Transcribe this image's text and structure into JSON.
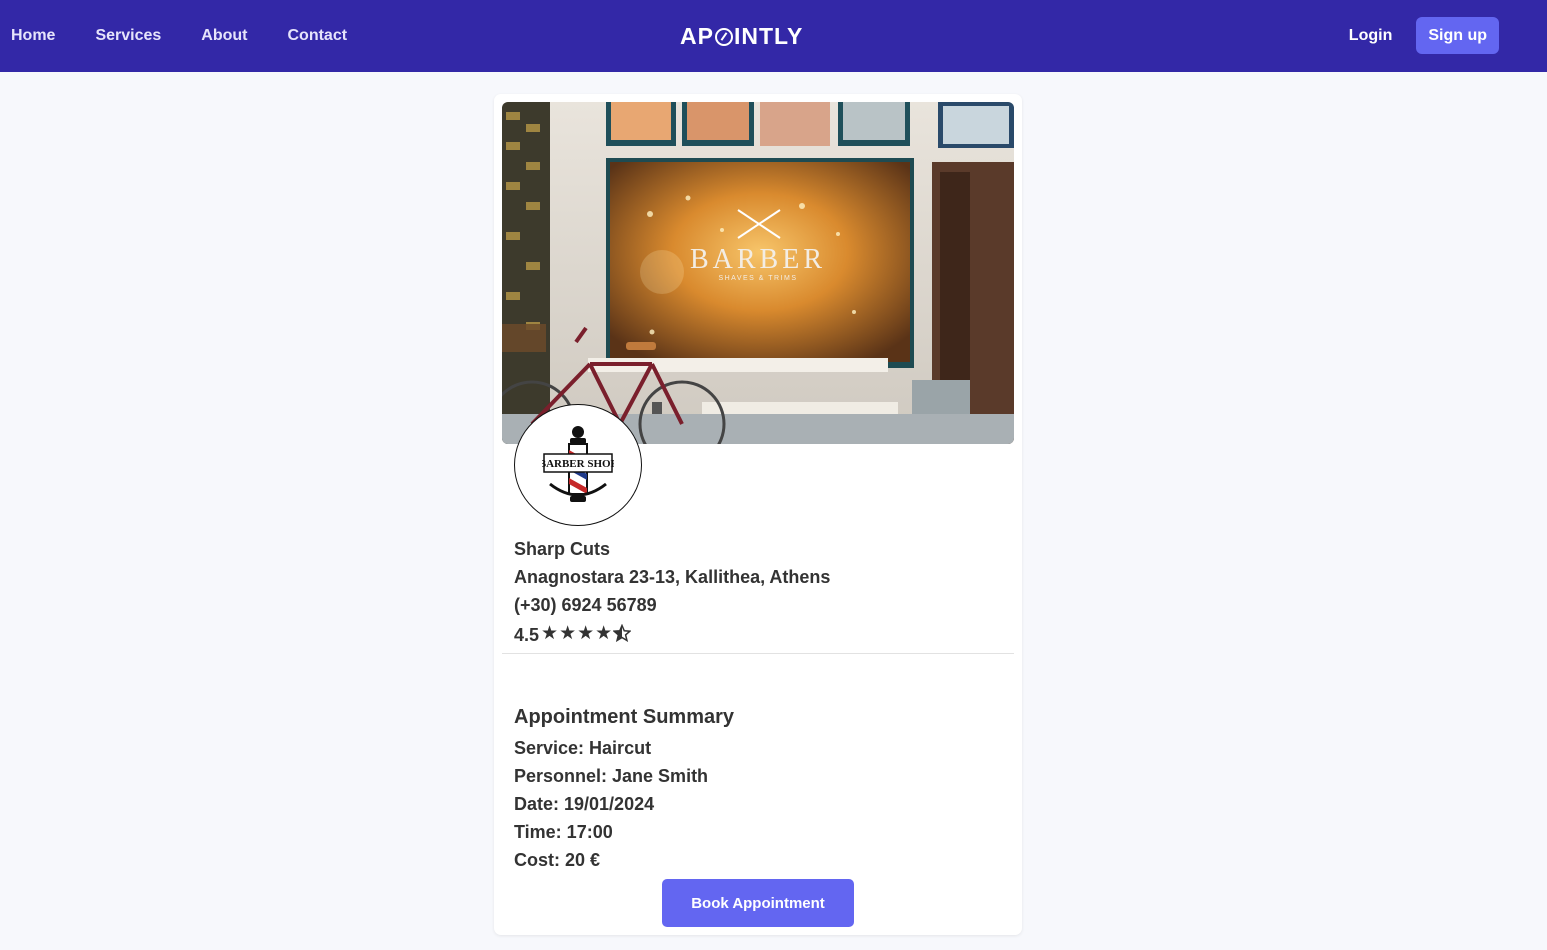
{
  "header": {
    "nav": [
      "Home",
      "Services",
      "About",
      "Contact"
    ],
    "brand": {
      "before": "AP",
      "after": "INTLY"
    },
    "login_label": "Login",
    "signup_label": "Sign up"
  },
  "business": {
    "name": "Sharp Cuts",
    "address": "Anagnostara 23-13, Kallithea, Athens",
    "phone": "(+30) 6924 56789",
    "rating": "4.5",
    "rating_value": 4.5,
    "rating_max": 5,
    "cover_sign": "BARBER",
    "cover_sign_sub": "SHAVES & TRIMS",
    "logo_text": "BARBER SHOP"
  },
  "summary": {
    "title": "Appointment Summary",
    "service": "Service: Haircut",
    "personnel": "Personnel: Jane Smith",
    "date": "Date: 19/01/2024",
    "time": "Time: 17:00",
    "cost": "Cost: 20 €"
  },
  "book_label": "Book Appointment",
  "colors": {
    "header_bg": "#3328a7",
    "accent": "#6366f1",
    "page_bg": "#f7f8fc"
  },
  "icons": [
    "star-icon",
    "half-star-icon"
  ]
}
